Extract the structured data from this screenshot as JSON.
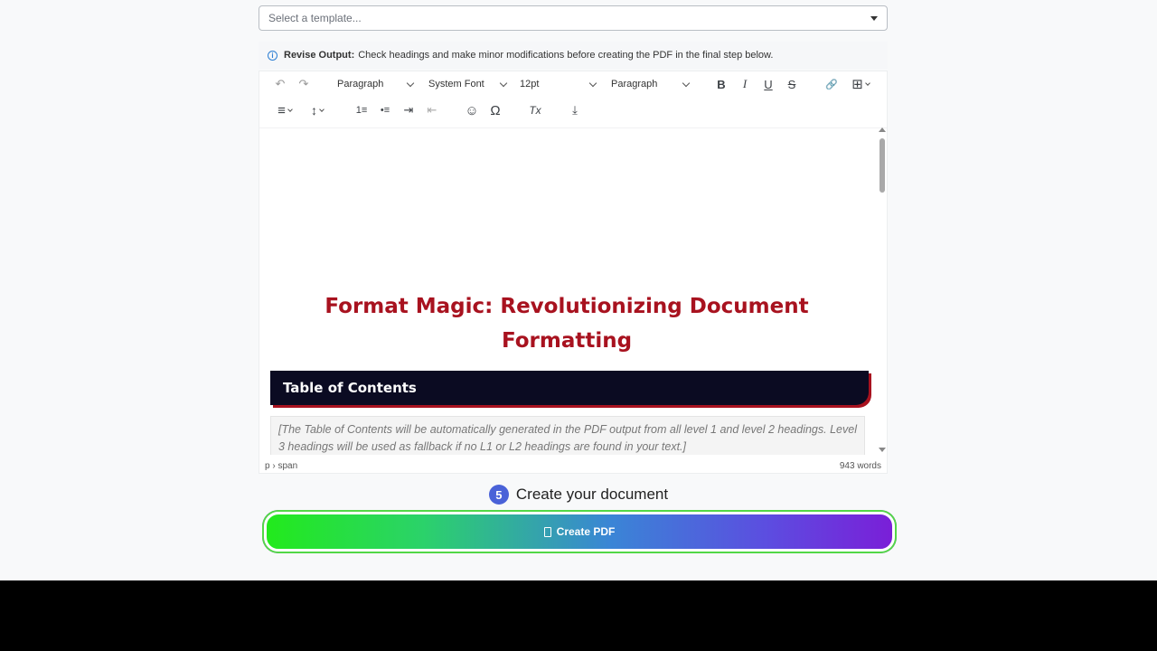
{
  "template_select": {
    "placeholder": "Select a template..."
  },
  "notice": {
    "label": "Revise Output:",
    "text": "Check headings and make minor modifications before creating the PDF in the final step below."
  },
  "toolbar": {
    "block_format": "Paragraph",
    "font_family": "System Font",
    "font_size": "12pt",
    "style": "Paragraph",
    "icons": {
      "undo": "↶",
      "redo": "↷",
      "bold": "B",
      "italic": "I",
      "underline": "U",
      "strikethrough": "S",
      "link": "🔗",
      "table": "⊞",
      "align": "≡",
      "line_height": "↕",
      "ordered_list": "1≡",
      "bullet_list": "•≡",
      "indent": "⇥",
      "outdent": "⇤",
      "emoji": "☺",
      "special_char": "Ω",
      "clear_format": "Tx",
      "page_break": "⤓"
    }
  },
  "document": {
    "title": "Format Magic: Revolutionizing Document Formatting",
    "toc_heading": "Table of Contents",
    "toc_note": "[The Table of Contents will be automatically generated in the PDF output from all level 1 and level 2 headings. Level 3 headings will be used as fallback if no L1 or L2 headings are found in your text.]"
  },
  "statusbar": {
    "path": "p › span",
    "word_count": "943 words"
  },
  "step": {
    "number": "5",
    "label": "Create your document"
  },
  "create_button": {
    "label": "Create PDF"
  }
}
